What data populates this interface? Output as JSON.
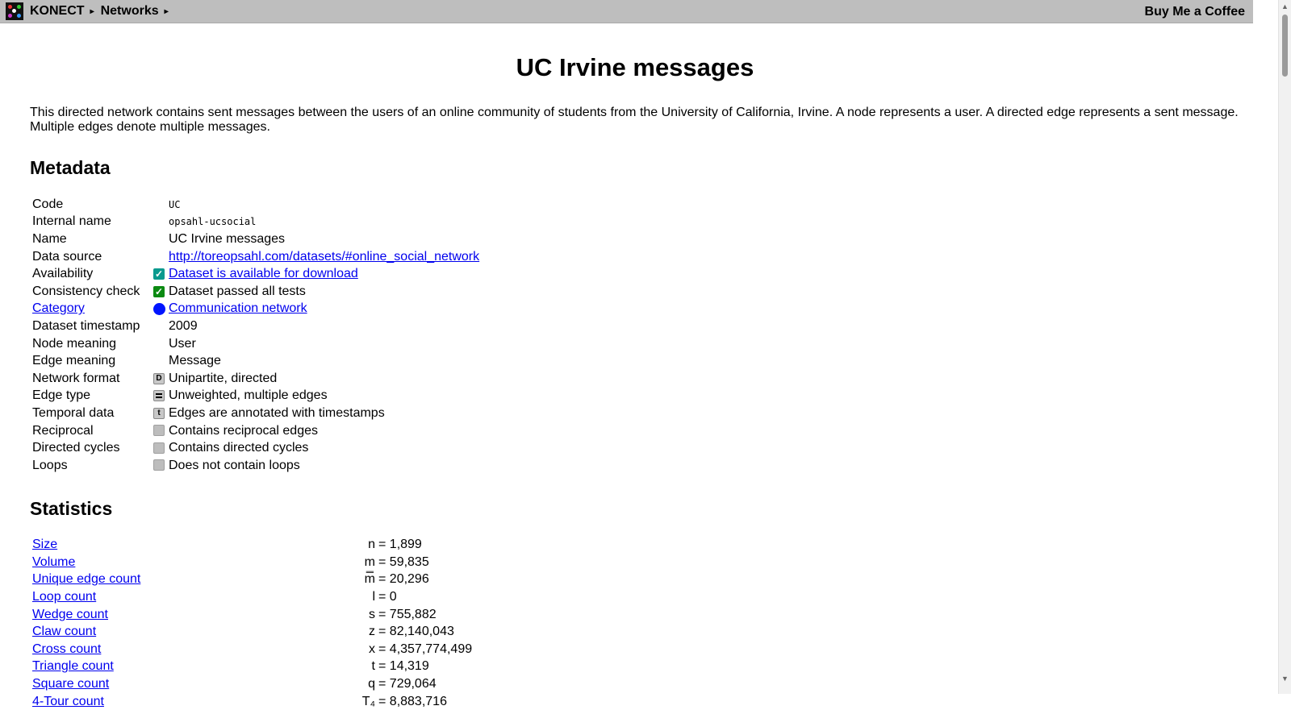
{
  "nav": {
    "home": "KONECT",
    "section": "Networks",
    "coffee": "Buy Me a Coffee"
  },
  "page": {
    "title": "UC Irvine messages",
    "description": "This directed network contains sent messages between the users of an online community of students from the University of California, Irvine. A node represents a user. A directed edge represents a sent message. Multiple edges denote multiple messages."
  },
  "metadata": {
    "heading": "Metadata",
    "rows": [
      {
        "key": "Code",
        "value": "UC",
        "mono": true
      },
      {
        "key": "Internal name",
        "value": "opsahl-ucsocial",
        "mono": true
      },
      {
        "key": "Name",
        "value": "UC Irvine messages"
      },
      {
        "key": "Data source",
        "value": "http://toreopsahl.com/datasets/#online_social_network",
        "link": true
      },
      {
        "key": "Availability",
        "value": "Dataset is available for download",
        "link": true,
        "icon": "teal-check-icon"
      },
      {
        "key": "Consistency check",
        "value": "Dataset passed all tests",
        "icon": "green-check-icon"
      },
      {
        "key": "Category",
        "value": "Communication network",
        "link": true,
        "keylink": true,
        "icon": "blue-dot-icon"
      },
      {
        "key": "Dataset timestamp",
        "value": "2009"
      },
      {
        "key": "Node meaning",
        "value": "User"
      },
      {
        "key": "Edge meaning",
        "value": "Message"
      },
      {
        "key": "Network format",
        "value": "Unipartite, directed",
        "icon": "letter-d-icon",
        "iconText": "D"
      },
      {
        "key": "Edge type",
        "value": "Unweighted, multiple edges",
        "icon": "double-line-icon"
      },
      {
        "key": "Temporal data",
        "value": "Edges are annotated with timestamps",
        "icon": "letter-t-icon",
        "iconText": "t"
      },
      {
        "key": "Reciprocal",
        "value": "Contains reciprocal edges",
        "icon": "gray-box-icon"
      },
      {
        "key": "Directed cycles",
        "value": "Contains directed cycles",
        "icon": "gray-box-icon"
      },
      {
        "key": "Loops",
        "value": "Does not contain loops",
        "icon": "gray-box-icon"
      }
    ]
  },
  "statistics": {
    "heading": "Statistics",
    "rows": [
      {
        "label": "Size",
        "sym": "n",
        "value": "1,899"
      },
      {
        "label": "Volume",
        "sym": "m",
        "value": "59,835"
      },
      {
        "label": "Unique edge count",
        "sym": "m̿",
        "value": "20,296"
      },
      {
        "label": "Loop count",
        "sym": "l",
        "value": "0"
      },
      {
        "label": "Wedge count",
        "sym": "s",
        "value": "755,882"
      },
      {
        "label": "Claw count",
        "sym": "z",
        "value": "82,140,043"
      },
      {
        "label": "Cross count",
        "sym": "x",
        "value": "4,357,774,499"
      },
      {
        "label": "Triangle count",
        "sym": "t",
        "value": "14,319"
      },
      {
        "label": "Square count",
        "sym": "q",
        "value": "729,064"
      },
      {
        "label": "4-Tour count",
        "sym": "T₄",
        "value": "8,883,716"
      }
    ]
  }
}
